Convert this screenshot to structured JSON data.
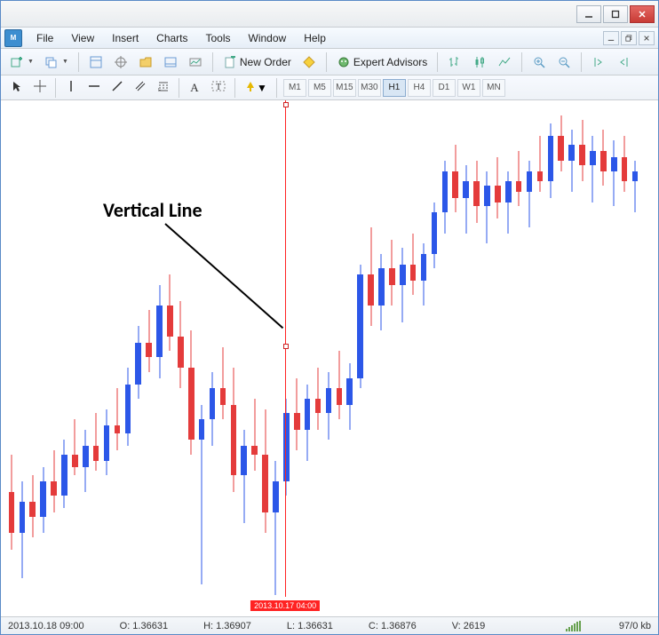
{
  "menu": {
    "file": "File",
    "view": "View",
    "insert": "Insert",
    "charts": "Charts",
    "tools": "Tools",
    "window": "Window",
    "help": "Help"
  },
  "toolbar": {
    "new_order": "New Order",
    "expert_advisors": "Expert Advisors"
  },
  "timeframes": {
    "m1": "M1",
    "m5": "M5",
    "m15": "M15",
    "m30": "M30",
    "h1": "H1",
    "h4": "H4",
    "d1": "D1",
    "w1": "W1",
    "mn": "MN",
    "active": "H1"
  },
  "annotation": {
    "label": "Vertical Line"
  },
  "vertical_line": {
    "time_label": "2013.10.17 04:00",
    "x_pct": 0.44
  },
  "status": {
    "time": "2013.10.18 09:00",
    "open": "O: 1.36631",
    "high": "H: 1.36907",
    "low": "L: 1.36631",
    "close": "C: 1.36876",
    "vol": "V: 2619",
    "net": "97/0 kb"
  },
  "chart_data": {
    "type": "candlestick",
    "title": "",
    "xlabel": "",
    "ylabel": "",
    "ylim": [
      1.349,
      1.3725
    ],
    "x_count": 60,
    "series": [
      {
        "name": "price",
        "candles": [
          {
            "o": 1.354,
            "h": 1.3558,
            "l": 1.3512,
            "c": 1.352
          },
          {
            "o": 1.352,
            "h": 1.3545,
            "l": 1.3498,
            "c": 1.3535
          },
          {
            "o": 1.3535,
            "h": 1.3548,
            "l": 1.3518,
            "c": 1.3528
          },
          {
            "o": 1.3528,
            "h": 1.3552,
            "l": 1.352,
            "c": 1.3545
          },
          {
            "o": 1.3545,
            "h": 1.356,
            "l": 1.353,
            "c": 1.3538
          },
          {
            "o": 1.3538,
            "h": 1.3565,
            "l": 1.3532,
            "c": 1.3558
          },
          {
            "o": 1.3558,
            "h": 1.3575,
            "l": 1.3548,
            "c": 1.3552
          },
          {
            "o": 1.3552,
            "h": 1.357,
            "l": 1.354,
            "c": 1.3562
          },
          {
            "o": 1.3562,
            "h": 1.3578,
            "l": 1.355,
            "c": 1.3555
          },
          {
            "o": 1.3555,
            "h": 1.358,
            "l": 1.3548,
            "c": 1.3572
          },
          {
            "o": 1.3572,
            "h": 1.359,
            "l": 1.356,
            "c": 1.3568
          },
          {
            "o": 1.3568,
            "h": 1.36,
            "l": 1.3562,
            "c": 1.3592
          },
          {
            "o": 1.3592,
            "h": 1.362,
            "l": 1.3585,
            "c": 1.3612
          },
          {
            "o": 1.3612,
            "h": 1.3628,
            "l": 1.3598,
            "c": 1.3605
          },
          {
            "o": 1.3605,
            "h": 1.364,
            "l": 1.3595,
            "c": 1.363
          },
          {
            "o": 1.363,
            "h": 1.3645,
            "l": 1.3608,
            "c": 1.3615
          },
          {
            "o": 1.3615,
            "h": 1.3632,
            "l": 1.359,
            "c": 1.36
          },
          {
            "o": 1.36,
            "h": 1.3618,
            "l": 1.3558,
            "c": 1.3565
          },
          {
            "o": 1.3565,
            "h": 1.3582,
            "l": 1.3495,
            "c": 1.3575
          },
          {
            "o": 1.3575,
            "h": 1.3598,
            "l": 1.3562,
            "c": 1.359
          },
          {
            "o": 1.359,
            "h": 1.361,
            "l": 1.3575,
            "c": 1.3582
          },
          {
            "o": 1.3582,
            "h": 1.36,
            "l": 1.354,
            "c": 1.3548
          },
          {
            "o": 1.3548,
            "h": 1.357,
            "l": 1.3525,
            "c": 1.3562
          },
          {
            "o": 1.3562,
            "h": 1.3585,
            "l": 1.355,
            "c": 1.3558
          },
          {
            "o": 1.3558,
            "h": 1.358,
            "l": 1.352,
            "c": 1.353
          },
          {
            "o": 1.353,
            "h": 1.3555,
            "l": 1.349,
            "c": 1.3545
          },
          {
            "o": 1.3545,
            "h": 1.3585,
            "l": 1.3538,
            "c": 1.3578
          },
          {
            "o": 1.3578,
            "h": 1.3595,
            "l": 1.356,
            "c": 1.357
          },
          {
            "o": 1.357,
            "h": 1.3592,
            "l": 1.3555,
            "c": 1.3585
          },
          {
            "o": 1.3585,
            "h": 1.36,
            "l": 1.357,
            "c": 1.3578
          },
          {
            "o": 1.3578,
            "h": 1.3598,
            "l": 1.3565,
            "c": 1.359
          },
          {
            "o": 1.359,
            "h": 1.3608,
            "l": 1.3575,
            "c": 1.3582
          },
          {
            "o": 1.3582,
            "h": 1.3602,
            "l": 1.357,
            "c": 1.3595
          },
          {
            "o": 1.3595,
            "h": 1.365,
            "l": 1.359,
            "c": 1.3645
          },
          {
            "o": 1.3645,
            "h": 1.3668,
            "l": 1.362,
            "c": 1.363
          },
          {
            "o": 1.363,
            "h": 1.3655,
            "l": 1.3618,
            "c": 1.3648
          },
          {
            "o": 1.3648,
            "h": 1.3662,
            "l": 1.363,
            "c": 1.364
          },
          {
            "o": 1.364,
            "h": 1.3658,
            "l": 1.3622,
            "c": 1.365
          },
          {
            "o": 1.365,
            "h": 1.3665,
            "l": 1.3635,
            "c": 1.3642
          },
          {
            "o": 1.3642,
            "h": 1.366,
            "l": 1.363,
            "c": 1.3655
          },
          {
            "o": 1.3655,
            "h": 1.368,
            "l": 1.3648,
            "c": 1.3675
          },
          {
            "o": 1.3675,
            "h": 1.37,
            "l": 1.3665,
            "c": 1.3695
          },
          {
            "o": 1.3695,
            "h": 1.3708,
            "l": 1.3675,
            "c": 1.3682
          },
          {
            "o": 1.3682,
            "h": 1.3698,
            "l": 1.3665,
            "c": 1.369
          },
          {
            "o": 1.369,
            "h": 1.37,
            "l": 1.367,
            "c": 1.3678
          },
          {
            "o": 1.3678,
            "h": 1.3695,
            "l": 1.366,
            "c": 1.3688
          },
          {
            "o": 1.3688,
            "h": 1.3702,
            "l": 1.3672,
            "c": 1.368
          },
          {
            "o": 1.368,
            "h": 1.3695,
            "l": 1.3665,
            "c": 1.369
          },
          {
            "o": 1.369,
            "h": 1.3705,
            "l": 1.3678,
            "c": 1.3685
          },
          {
            "o": 1.3685,
            "h": 1.37,
            "l": 1.3668,
            "c": 1.3695
          },
          {
            "o": 1.3695,
            "h": 1.3712,
            "l": 1.3685,
            "c": 1.369
          },
          {
            "o": 1.369,
            "h": 1.3718,
            "l": 1.3682,
            "c": 1.3712
          },
          {
            "o": 1.3712,
            "h": 1.3722,
            "l": 1.3695,
            "c": 1.37
          },
          {
            "o": 1.37,
            "h": 1.3715,
            "l": 1.3685,
            "c": 1.3708
          },
          {
            "o": 1.3708,
            "h": 1.372,
            "l": 1.369,
            "c": 1.3698
          },
          {
            "o": 1.3698,
            "h": 1.3712,
            "l": 1.368,
            "c": 1.3705
          },
          {
            "o": 1.3705,
            "h": 1.3715,
            "l": 1.3688,
            "c": 1.3695
          },
          {
            "o": 1.3695,
            "h": 1.371,
            "l": 1.3678,
            "c": 1.3702
          },
          {
            "o": 1.3702,
            "h": 1.3712,
            "l": 1.3685,
            "c": 1.369
          },
          {
            "o": 1.369,
            "h": 1.37,
            "l": 1.3675,
            "c": 1.3695
          }
        ]
      }
    ]
  }
}
